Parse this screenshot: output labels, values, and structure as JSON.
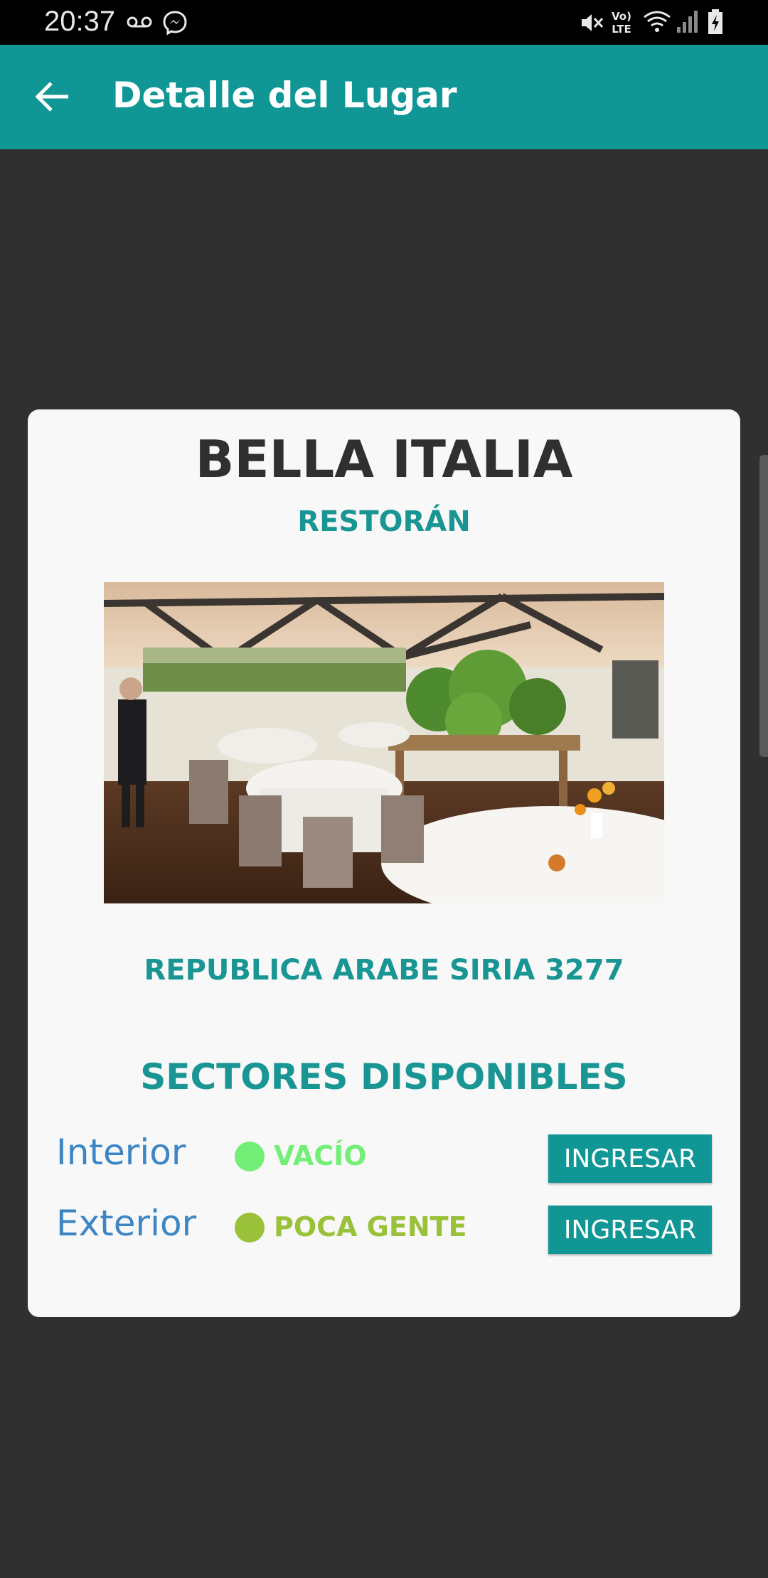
{
  "status_bar": {
    "time": "20:37",
    "icons": [
      "voicemail-icon",
      "messenger-icon",
      "mute-icon",
      "volte-icon",
      "wifi-icon",
      "signal-icon",
      "battery-icon"
    ]
  },
  "app_bar": {
    "title": "Detalle del Lugar",
    "back_icon": "arrow-back-icon"
  },
  "place": {
    "name": "BELLA ITALIA",
    "type": "RESTORÁN",
    "address": "REPUBLICA ARABE SIRIA 3277"
  },
  "sectors": {
    "title": "SECTORES DISPONIBLES",
    "items": [
      {
        "name": "Interior",
        "status": "VACÍO",
        "status_color": "#73ef77",
        "label_color": "#73ef77",
        "button": "INGRESAR"
      },
      {
        "name": "Exterior",
        "status": "POCA GENTE",
        "status_color": "#9ac13a",
        "label_color": "#9ac13a",
        "button": "INGRESAR"
      }
    ]
  },
  "colors": {
    "primary": "#119696",
    "accent_text": "#199593",
    "background": "#303030",
    "card": "#f8f8f8",
    "sector_name": "#3d86c6"
  }
}
